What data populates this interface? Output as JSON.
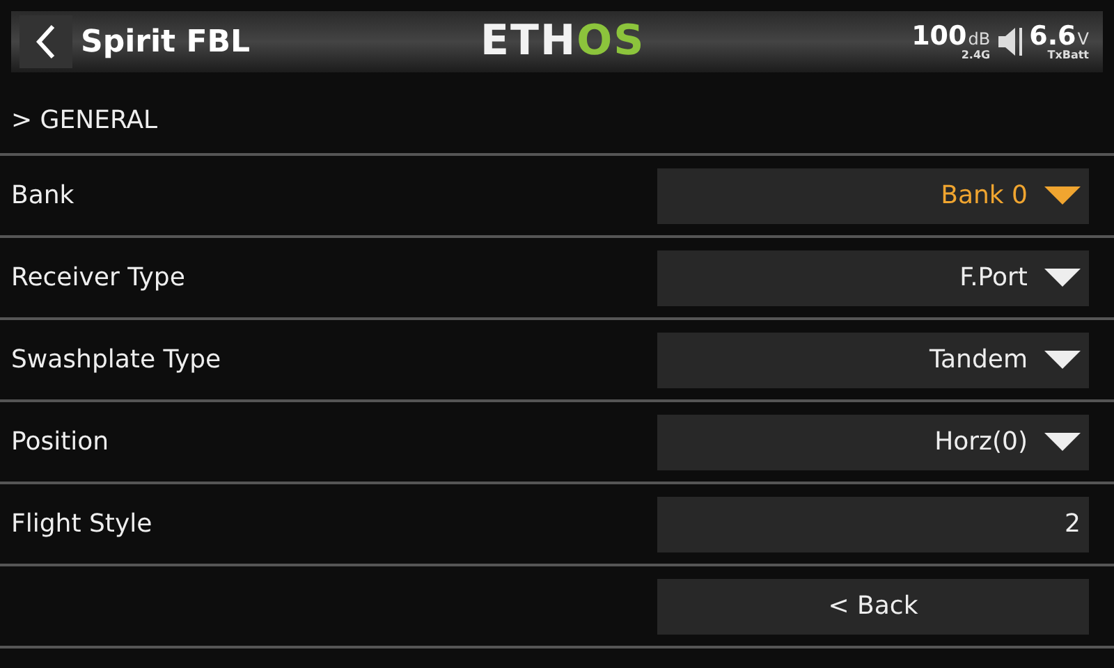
{
  "header": {
    "title": "Spirit FBL",
    "logo": {
      "main": "ETH",
      "accent": "OS"
    },
    "rssi": {
      "value": "100",
      "unit": "dB",
      "band": "2.4G"
    },
    "battery": {
      "value": "6.6",
      "unit": "V",
      "label": "TxBatt"
    }
  },
  "section": "> GENERAL",
  "rows": [
    {
      "label": "Bank",
      "kind": "dropdown",
      "value": "Bank 0",
      "selected": true
    },
    {
      "label": "Receiver Type",
      "kind": "dropdown",
      "value": "F.Port",
      "selected": false
    },
    {
      "label": "Swashplate Type",
      "kind": "dropdown",
      "value": "Tandem",
      "selected": false
    },
    {
      "label": "Position",
      "kind": "dropdown",
      "value": "Horz(0)",
      "selected": false
    },
    {
      "label": "Flight Style",
      "kind": "number",
      "value": "2",
      "selected": false
    },
    {
      "kind": "button",
      "value": "< Back",
      "selected": false
    }
  ]
}
